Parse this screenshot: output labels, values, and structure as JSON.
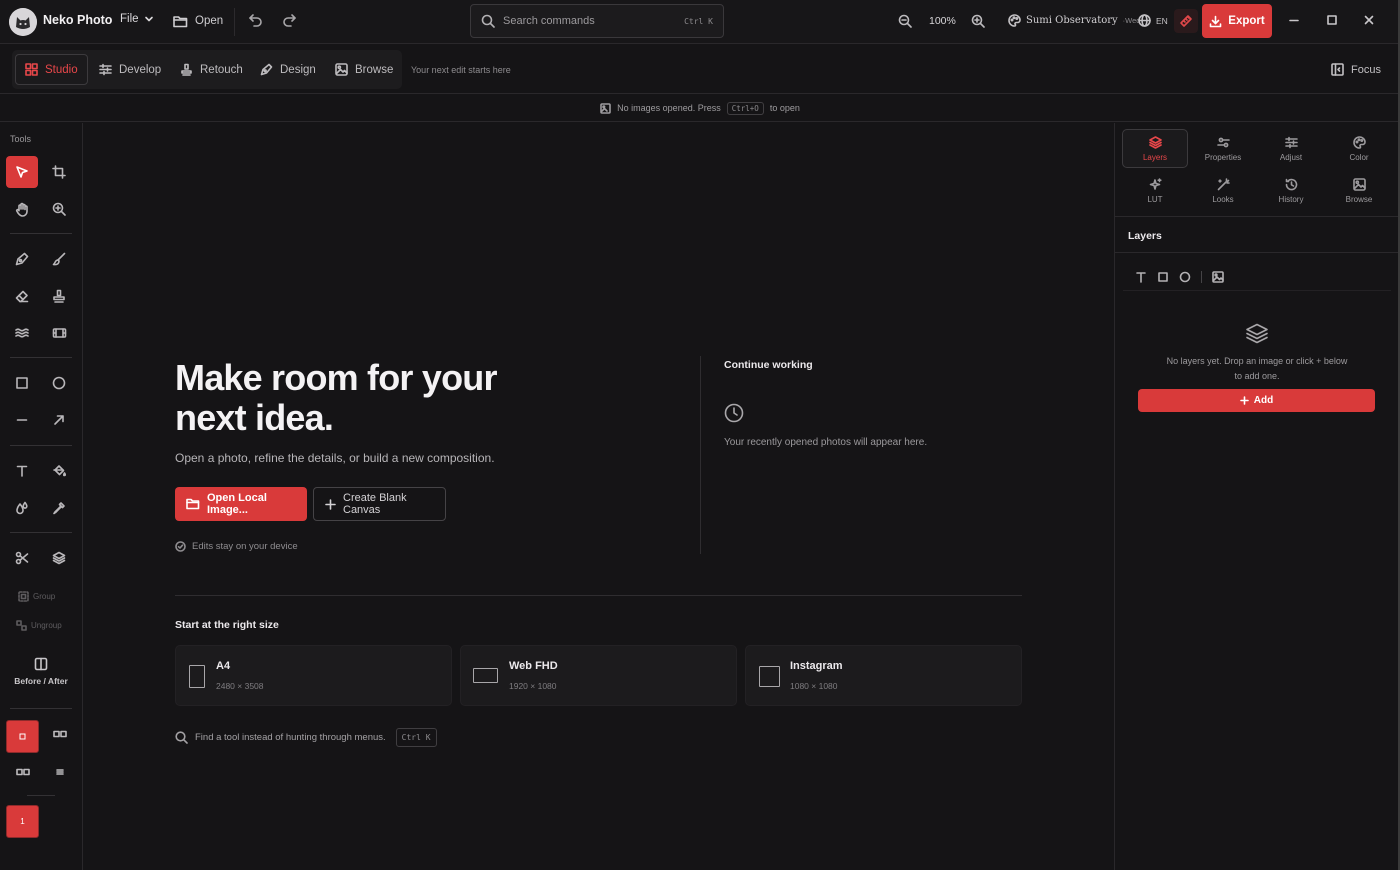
{
  "app": {
    "name": "Neko Photo"
  },
  "titlebar": {
    "file_menu": "File",
    "open_label": "Open",
    "search_placeholder": "Search commands",
    "search_shortcut": "Ctrl K",
    "zoom_level": "100%",
    "theme_name": "Sumi Observatory",
    "theme_sub": "·Wed",
    "language": "EN",
    "export_label": "Export"
  },
  "workspace_tabs": [
    {
      "label": "Studio",
      "icon": "grid-icon",
      "active": true
    },
    {
      "label": "Develop",
      "icon": "sliders-icon",
      "active": false
    },
    {
      "label": "Retouch",
      "icon": "stamp-icon",
      "active": false
    },
    {
      "label": "Design",
      "icon": "pen-icon",
      "active": false
    },
    {
      "label": "Browse",
      "icon": "image-icon",
      "active": false
    }
  ],
  "tabsbar": {
    "next_edit": "Your next edit starts here",
    "focus_label": "Focus"
  },
  "infobar": {
    "message": "No images opened. Press",
    "shortcut": "Ctrl+O",
    "suffix": "to open"
  },
  "tools": {
    "title": "Tools",
    "group_label": "Group",
    "ungroup_label": "Ungroup",
    "before_after_label": "Before / After",
    "swatch_label": "1"
  },
  "hero": {
    "title": "Make room for your next idea.",
    "subtitle": "Open a photo, refine the details, or build a new composition.",
    "open_local": "Open Local Image...",
    "create_blank": "Create Blank Canvas",
    "device_note": "Edits stay on your device"
  },
  "continue": {
    "title": "Continue working",
    "empty_note": "Your recently opened photos will appear here."
  },
  "sizes": {
    "title": "Start at the right size",
    "presets": [
      {
        "name": "A4",
        "dims": "2480 × 3508"
      },
      {
        "name": "Web FHD",
        "dims": "1920 × 1080"
      },
      {
        "name": "Instagram",
        "dims": "1080 × 1080"
      }
    ]
  },
  "find_tool": {
    "text": "Find a tool instead of hunting through menus.",
    "shortcut": "Ctrl K"
  },
  "right_panel": {
    "tabs": [
      {
        "label": "Layers",
        "icon": "layers-icon",
        "active": true
      },
      {
        "label": "Properties",
        "icon": "properties-icon",
        "active": false
      },
      {
        "label": "Adjust",
        "icon": "adjust-icon",
        "active": false
      },
      {
        "label": "Color",
        "icon": "palette-icon",
        "active": false
      },
      {
        "label": "LUT",
        "icon": "sparkle-icon",
        "active": false
      },
      {
        "label": "Looks",
        "icon": "wand-icon",
        "active": false
      },
      {
        "label": "History",
        "icon": "history-icon",
        "active": false
      },
      {
        "label": "Browse",
        "icon": "image-icon",
        "active": false
      }
    ],
    "layers_title": "Layers",
    "empty_message": "No layers yet. Drop an image or click + below to add one.",
    "add_label": "Add"
  },
  "colors": {
    "accent": "#d93a3a",
    "background": "#151416",
    "panel": "#1c1b1d"
  }
}
